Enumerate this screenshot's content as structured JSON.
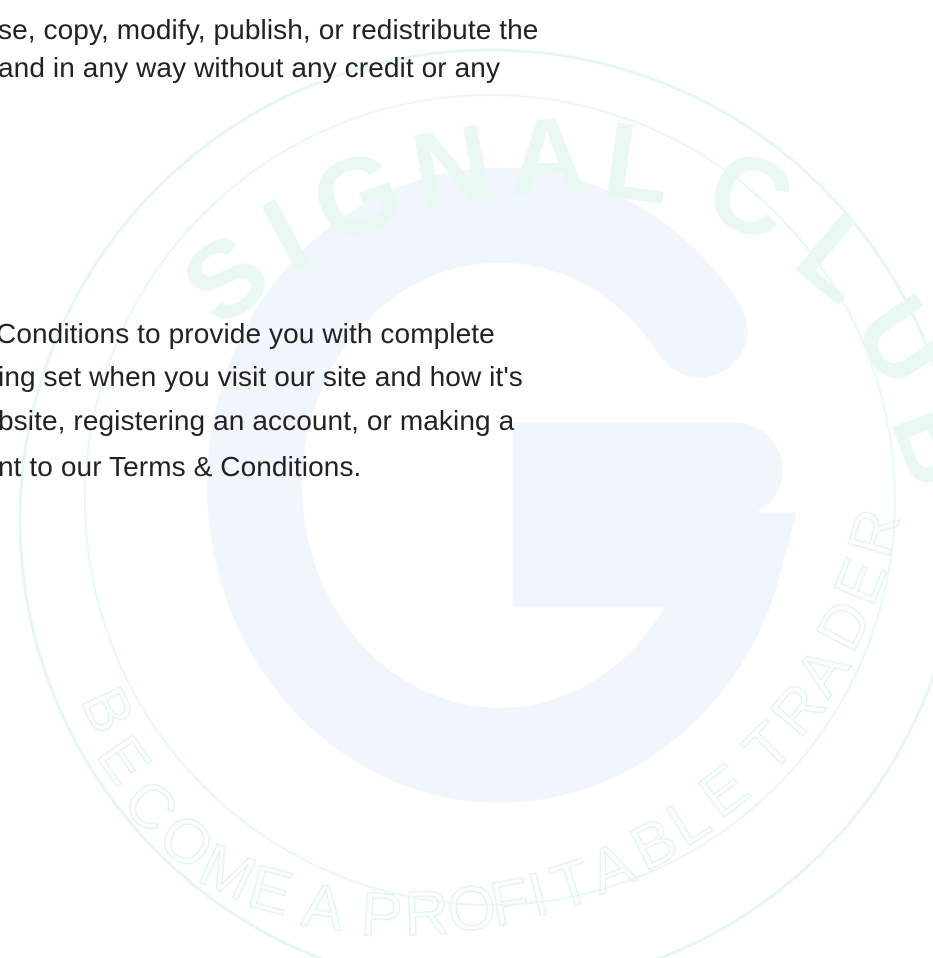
{
  "watermark": {
    "brand_text": "SIGNAL CLUB",
    "tagline": "BECOME A PROFITABLE TRADER",
    "color": "#dff5ee",
    "logo_color": "#eef6fc"
  },
  "text_color": "#222222",
  "paragraphs": [
    {
      "lines": [
        "se, copy, modify, publish, or redistribute the",
        " and in any way without any credit or any"
      ]
    },
    {
      "lines": [
        " Conditions to provide you with complete",
        "ing set when you visit our site and how it's",
        "bsite, registering an account, or making a",
        "nt to our Terms & Conditions."
      ]
    }
  ]
}
